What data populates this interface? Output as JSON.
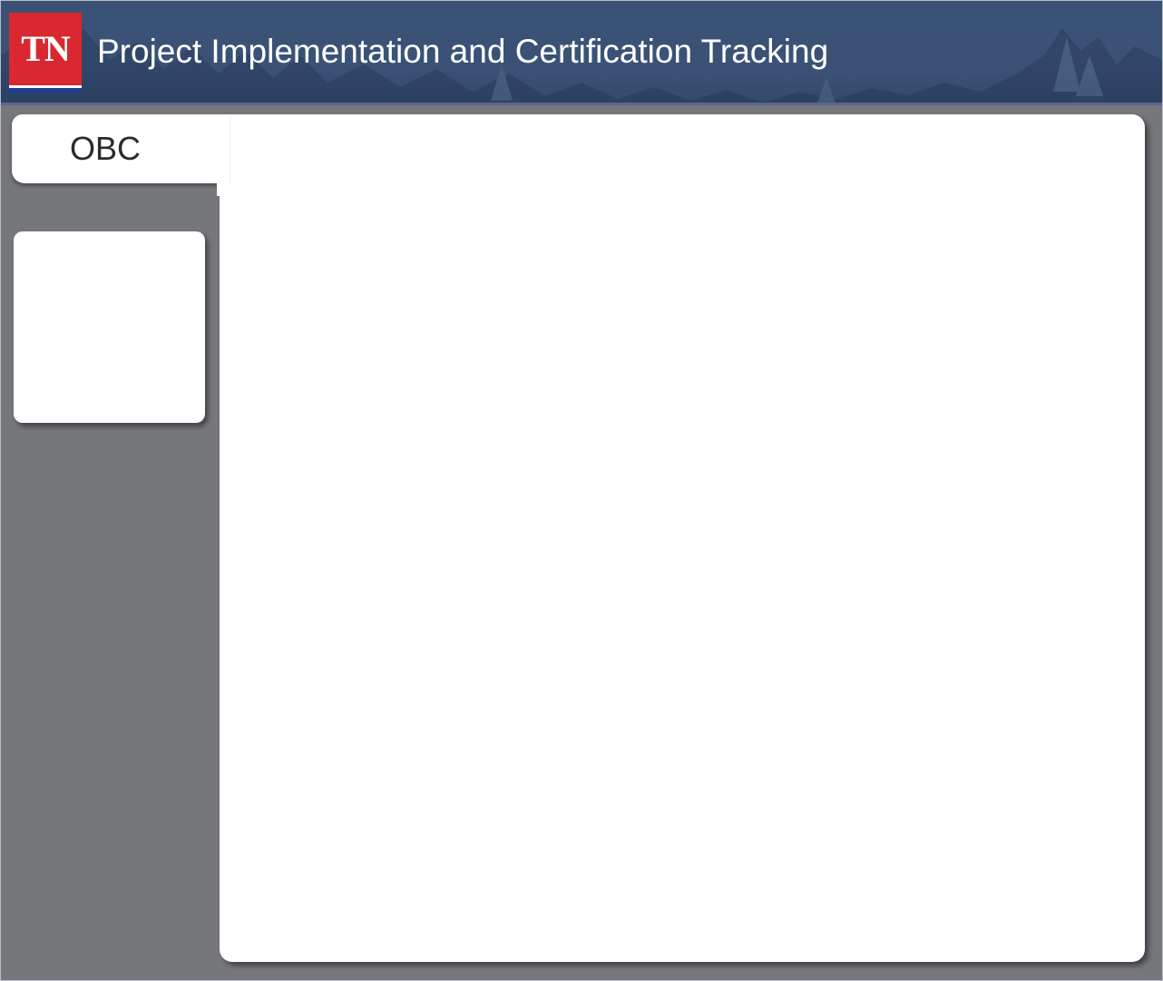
{
  "header": {
    "logo_text": "TN",
    "title": "Project Implementation and Certification Tracking"
  },
  "tabs": [
    {
      "label": "OBC"
    }
  ],
  "colors": {
    "header_bg": "#3b5277",
    "logo_red": "#d9282f",
    "logo_blue": "#1f3f8e",
    "sidebar_bg": "#76777b",
    "panel_bg": "#ffffff"
  }
}
